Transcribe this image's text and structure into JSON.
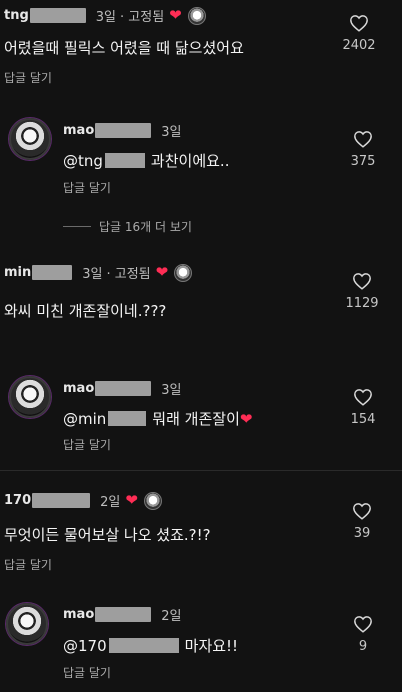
{
  "comments": [
    {
      "user": "tng",
      "time": "3일",
      "pinned": "· 고정됨",
      "text": "어렸을때 필릭스 어렸을 때 닮으셨어요",
      "reply": "답글 달기",
      "likes": "2402"
    },
    {
      "user": "mao",
      "time": "3일",
      "mention": "@tng",
      "text": "과찬이에요..",
      "reply": "답글 달기",
      "likes": "375"
    },
    {
      "view_more": "답글 16개 더 보기"
    },
    {
      "user": "min",
      "time": "3일",
      "pinned": "· 고정됨",
      "text": "와씨 미친 개존잘이네.???",
      "reply": "답글 달기",
      "likes": "1129"
    },
    {
      "user": "mao",
      "time": "3일",
      "mention": "@min",
      "text": "뭐래 개존잘이",
      "reply": "답글 달기",
      "likes": "154"
    },
    {
      "user": "170",
      "time": "2일",
      "text": "무엇이든 물어보살 나오 셨죠.?!?",
      "reply": "답글 달기",
      "likes": "39"
    },
    {
      "user": "mao",
      "time": "2일",
      "mention": "@170",
      "text": "마자요!!",
      "reply": "답글 달기",
      "likes": "9"
    }
  ],
  "icons": {
    "like": "heart-outline-icon",
    "pinned_heart": "heart-filled-icon",
    "creator_avatar": "avatar-icon"
  },
  "colors": {
    "background": "#121212",
    "heart": "#ff2d55"
  }
}
